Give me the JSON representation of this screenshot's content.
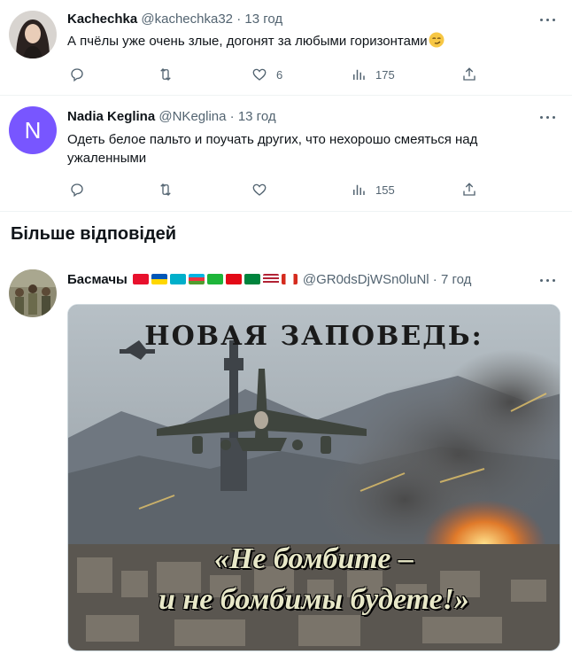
{
  "tweets": [
    {
      "name": "Kachechka",
      "handle": "@kachechka32",
      "dot": "·",
      "time": "13 год",
      "text": "А пчёлы уже очень злые, догонят за любыми горизонтами",
      "emoji": "smirk-face",
      "reply_count": "",
      "retweet_count": "",
      "like_count": "6",
      "views_count": "175"
    },
    {
      "name": "Nadia Keglina",
      "avatar_letter": "N",
      "handle": "@NKeglina",
      "dot": "·",
      "time": "13 год",
      "text": "Одеть белое пальто и поучать других, что нехорошо смеяться над ужаленными",
      "reply_count": "",
      "retweet_count": "",
      "like_count": "",
      "views_count": "155"
    }
  ],
  "more_replies_title": "Більше відповідей",
  "reply3": {
    "name": "Басмачы",
    "flags": [
      "kg",
      "ua",
      "kz",
      "az",
      "uz",
      "tr",
      "tm",
      "us",
      "ca"
    ],
    "handle": "@GR0dsDjWSn0luNl",
    "dot": "·",
    "time": "7 год",
    "image_top_text": "НОВАЯ ЗАПОВЕДЬ:",
    "image_bottom_line1": "«Не бомбите –",
    "image_bottom_line2": "и не бомбимы будете!»"
  },
  "colors": {
    "text_primary": "#0f1419",
    "text_secondary": "#536471",
    "divider": "#eff3f4",
    "avatar_purple": "#7856ff"
  },
  "icons": [
    "reply-icon",
    "retweet-icon",
    "like-icon",
    "views-icon",
    "share-icon",
    "more-icon"
  ]
}
